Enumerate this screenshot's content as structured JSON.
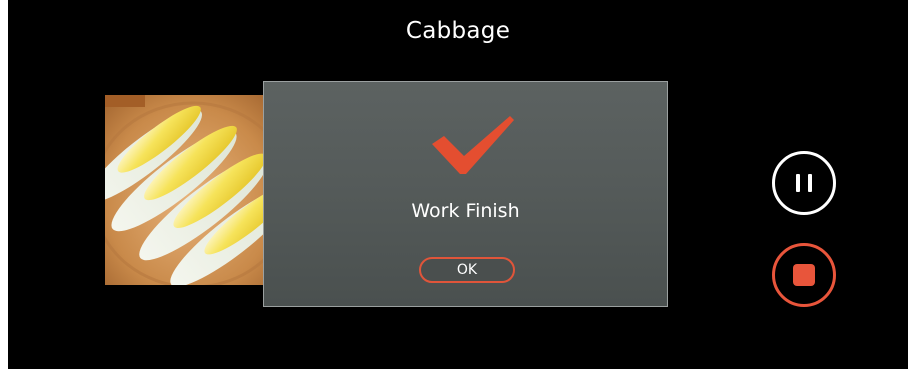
{
  "header": {
    "title": "Cabbage"
  },
  "food_image": {
    "subject": "cabbage"
  },
  "dialog": {
    "icon": "checkmark-icon",
    "message": "Work Finish",
    "ok_label": "OK"
  },
  "controls": {
    "pause_icon": "pause-icon",
    "stop_icon": "stop-icon"
  },
  "colors": {
    "background": "#000000",
    "accent": "#e8553b",
    "dialog_bg": "#555b5a",
    "text": "#ffffff"
  }
}
